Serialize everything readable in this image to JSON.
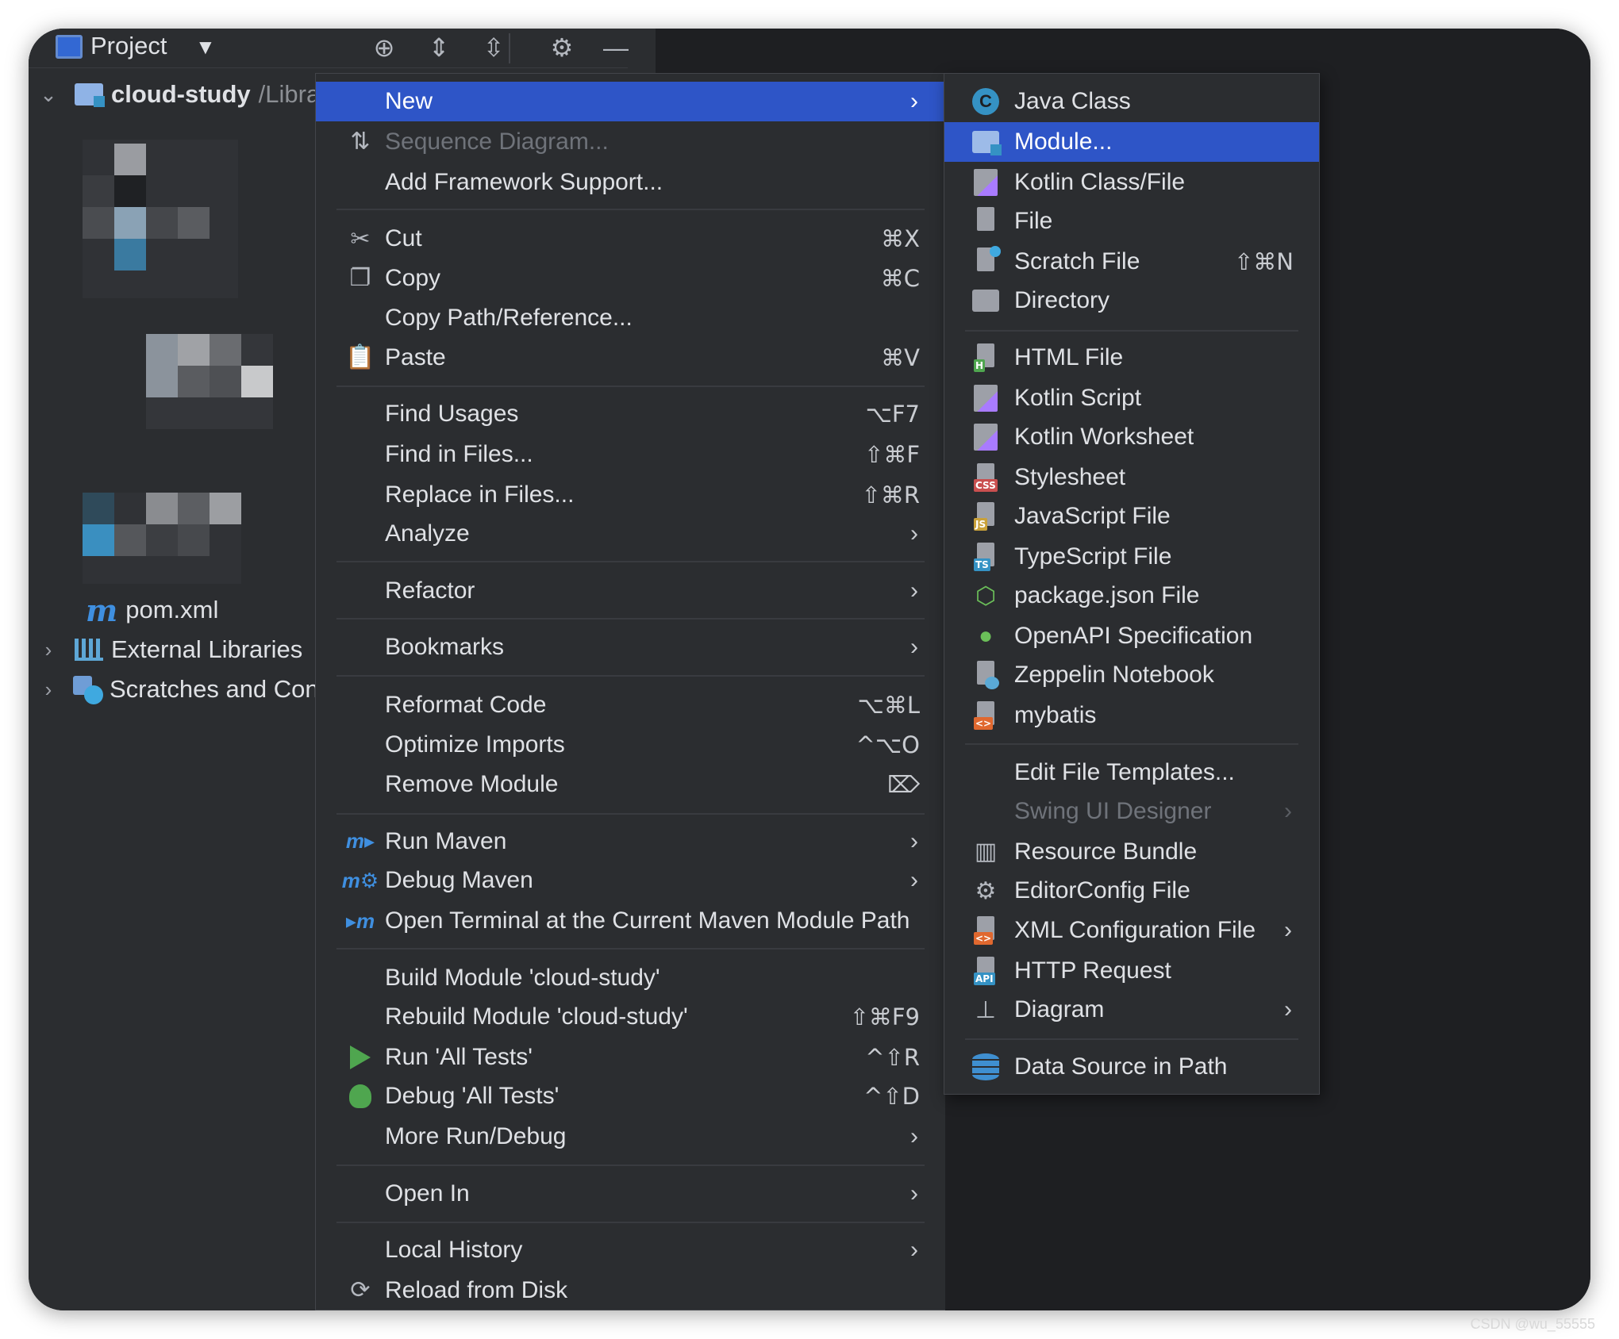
{
  "project_toolbar": {
    "title": "Project",
    "icons": [
      "project-view-icon",
      "dropdown-caret-icon",
      "locate-icon",
      "expand-all-icon",
      "collapse-all-icon",
      "gear-icon",
      "minimize-icon"
    ]
  },
  "tree": {
    "root_name": "cloud-study",
    "root_path": "/Libra",
    "pom": "pom.xml",
    "external_libraries": "External Libraries",
    "scratches": "Scratches and Con"
  },
  "context_menu": {
    "items": [
      {
        "label": "New",
        "selected": true,
        "submenu": true
      },
      {
        "label": "Sequence Diagram...",
        "disabled": true,
        "icon": "sequence-diagram-icon"
      },
      {
        "label": "Add Framework Support..."
      },
      {
        "label": "Cut",
        "shortcut": "⌘X",
        "icon": "scissors-icon"
      },
      {
        "label": "Copy",
        "shortcut": "⌘C",
        "icon": "copy-icon"
      },
      {
        "label": "Copy Path/Reference..."
      },
      {
        "label": "Paste",
        "shortcut": "⌘V",
        "icon": "clipboard-icon"
      },
      {
        "label": "Find Usages",
        "shortcut": "⌥F7"
      },
      {
        "label": "Find in Files...",
        "shortcut": "⇧⌘F"
      },
      {
        "label": "Replace in Files...",
        "shortcut": "⇧⌘R"
      },
      {
        "label": "Analyze",
        "submenu": true
      },
      {
        "label": "Refactor",
        "submenu": true
      },
      {
        "label": "Bookmarks",
        "submenu": true
      },
      {
        "label": "Reformat Code",
        "shortcut": "⌥⌘L"
      },
      {
        "label": "Optimize Imports",
        "shortcut": "^⌥O"
      },
      {
        "label": "Remove Module",
        "shortcut": "⌦"
      },
      {
        "label": "Run Maven",
        "submenu": true,
        "icon": "maven-run-icon"
      },
      {
        "label": "Debug Maven",
        "submenu": true,
        "icon": "maven-debug-icon"
      },
      {
        "label": "Open Terminal at the Current Maven Module Path",
        "icon": "maven-terminal-icon"
      },
      {
        "label": "Build Module 'cloud-study'"
      },
      {
        "label": "Rebuild Module 'cloud-study'",
        "shortcut": "⇧⌘F9"
      },
      {
        "label": "Run 'All Tests'",
        "shortcut": "^⇧R",
        "icon": "run-icon"
      },
      {
        "label": "Debug 'All Tests'",
        "shortcut": "^⇧D",
        "icon": "debug-icon"
      },
      {
        "label": "More Run/Debug",
        "submenu": true
      },
      {
        "label": "Open In",
        "submenu": true
      },
      {
        "label": "Local History",
        "submenu": true
      },
      {
        "label": "Reload from Disk",
        "icon": "reload-icon"
      }
    ]
  },
  "new_submenu": {
    "items": [
      {
        "label": "Java Class",
        "icon": "java-class-icon"
      },
      {
        "label": "Module...",
        "selected": true,
        "icon": "module-icon"
      },
      {
        "label": "Kotlin Class/File",
        "icon": "kotlin-file-icon"
      },
      {
        "label": "File",
        "icon": "file-icon"
      },
      {
        "label": "Scratch File",
        "shortcut": "⇧⌘N",
        "icon": "scratch-file-icon"
      },
      {
        "label": "Directory",
        "icon": "directory-icon"
      },
      {
        "label": "HTML File",
        "icon": "html-file-icon",
        "tag": "H",
        "tag_color": "#4fa64f"
      },
      {
        "label": "Kotlin Script",
        "icon": "kotlin-script-icon"
      },
      {
        "label": "Kotlin Worksheet",
        "icon": "kotlin-worksheet-icon"
      },
      {
        "label": "Stylesheet",
        "icon": "stylesheet-icon",
        "tag": "CSS",
        "tag_color": "#c94f4f"
      },
      {
        "label": "JavaScript File",
        "icon": "javascript-file-icon",
        "tag": "JS",
        "tag_color": "#c9a13a"
      },
      {
        "label": "TypeScript File",
        "icon": "typescript-file-icon",
        "tag": "TS",
        "tag_color": "#3592c4"
      },
      {
        "label": "package.json File",
        "icon": "nodejs-icon"
      },
      {
        "label": "OpenAPI Specification",
        "icon": "openapi-icon"
      },
      {
        "label": "Zeppelin Notebook",
        "icon": "zeppelin-icon"
      },
      {
        "label": "mybatis",
        "icon": "mybatis-icon",
        "tag": "<>",
        "tag_color": "#e0682f"
      },
      {
        "label": "Edit File Templates..."
      },
      {
        "label": "Swing UI Designer",
        "disabled": true,
        "submenu": true
      },
      {
        "label": "Resource Bundle",
        "icon": "resource-bundle-icon"
      },
      {
        "label": "EditorConfig File",
        "icon": "gear-icon"
      },
      {
        "label": "XML Configuration File",
        "submenu": true,
        "icon": "xml-file-icon",
        "tag": "<>",
        "tag_color": "#e0682f"
      },
      {
        "label": "HTTP Request",
        "icon": "http-request-icon",
        "tag": "API",
        "tag_color": "#3592c4"
      },
      {
        "label": "Diagram",
        "submenu": true,
        "icon": "diagram-icon"
      },
      {
        "label": "Data Source in Path",
        "icon": "database-icon"
      }
    ]
  },
  "colors": {
    "selection": "#2e55c7",
    "panel": "#2b2d30",
    "editor": "#1e1f22",
    "text": "#dfe1e5",
    "disabled_text": "#6f737a"
  },
  "watermark": "CSDN @wu_55555"
}
